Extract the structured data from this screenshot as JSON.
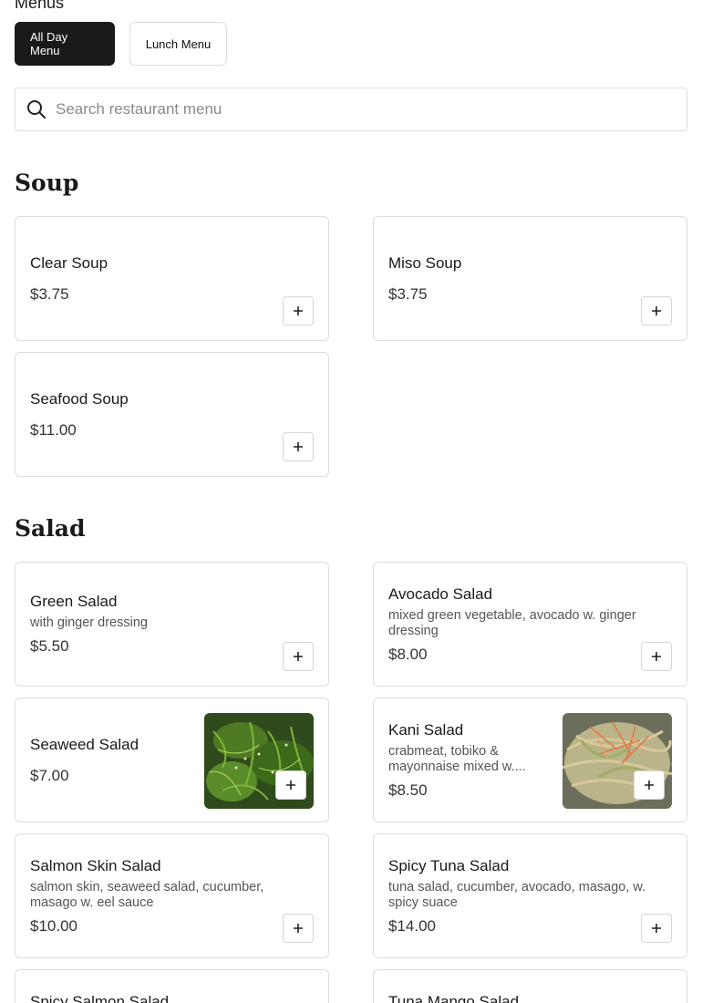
{
  "menus_heading": "Menus",
  "tabs": [
    {
      "label": "All Day Menu",
      "active": true
    },
    {
      "label": "Lunch Menu",
      "active": false
    }
  ],
  "search": {
    "placeholder": "Search restaurant menu"
  },
  "sections": [
    {
      "title": "Soup",
      "items": [
        {
          "name": "Clear Soup",
          "price": "$3.75"
        },
        {
          "name": "Miso Soup",
          "price": "$3.75"
        },
        {
          "name": "Seafood Soup",
          "price": "$11.00"
        }
      ]
    },
    {
      "title": "Salad",
      "items": [
        {
          "name": "Green Salad",
          "description": "with ginger dressing",
          "price": "$5.50"
        },
        {
          "name": "Avocado Salad",
          "description": "mixed green vegetable, avocado w. ginger dressing",
          "price": "$8.00"
        },
        {
          "name": "Seaweed Salad",
          "price": "$7.00",
          "image": "seaweed-salad-photo"
        },
        {
          "name": "Kani Salad",
          "description": "crabmeat, tobiko & mayonnaise mixed w....",
          "price": "$8.50",
          "image": "kani-salad-photo"
        },
        {
          "name": "Salmon Skin Salad",
          "description": "salmon skin, seaweed salad, cucumber, masago w. eel sauce",
          "price": "$10.00"
        },
        {
          "name": "Spicy Tuna Salad",
          "description": "tuna salad, cucumber, avocado, masago, w. spicy suace",
          "price": "$14.00"
        },
        {
          "name": "Spicy Salmon Salad"
        },
        {
          "name": "Tuna Mango Salad"
        }
      ]
    }
  ],
  "icons": {
    "search": "search-icon",
    "add": "plus-icon"
  },
  "colors": {
    "active_tab_bg": "#1a1a1a",
    "border": "#dddddd"
  }
}
